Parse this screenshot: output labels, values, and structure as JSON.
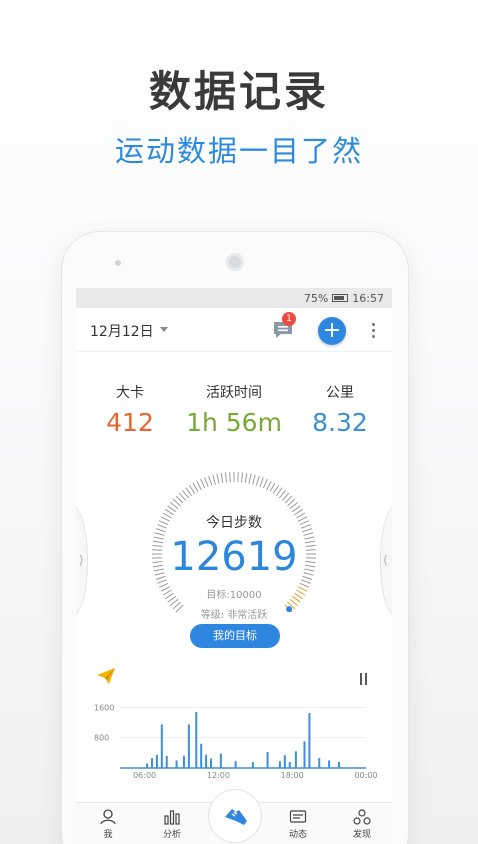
{
  "promo": {
    "title": "数据记录",
    "subtitle": "运动数据一目了然"
  },
  "status_bar": {
    "battery": "75%",
    "time": "16:57"
  },
  "app_bar": {
    "date": "12月12日",
    "message_badge": "1",
    "add_label": "+"
  },
  "stats": [
    {
      "label": "大卡",
      "value": "412",
      "color": "#e8662b"
    },
    {
      "label": "活跃时间",
      "value": "1h 56m",
      "color": "#77aa33"
    },
    {
      "label": "公里",
      "value": "8.32",
      "color": "#3d8fd8"
    }
  ],
  "gauge": {
    "label": "今日步数",
    "steps": "12619",
    "goal_text": "目标:10000",
    "level_text": "等级: 非常活跃",
    "button_label": "我的目标",
    "progress": 1.0
  },
  "chart_data": {
    "type": "bar",
    "y_ticks": [
      "1600",
      "800"
    ],
    "x_ticks": [
      "06:00",
      "12:00",
      "18:00",
      "00:00"
    ],
    "ylim": [
      0,
      1900
    ],
    "bar_hours": [
      6.2,
      6.6,
      7.0,
      7.4,
      7.8,
      8.6,
      9.2,
      9.6,
      10.2,
      10.6,
      11.0,
      11.4,
      12.2,
      13.4,
      14.8,
      16.0,
      17.0,
      17.4,
      17.8,
      18.3,
      19.0,
      19.4,
      20.2,
      21.0,
      21.8
    ],
    "values": [
      120,
      260,
      350,
      1150,
      320,
      200,
      320,
      1150,
      1480,
      640,
      350,
      250,
      380,
      180,
      160,
      420,
      180,
      340,
      160,
      440,
      700,
      1450,
      260,
      200,
      160
    ],
    "bar_color": "#3d8fd8",
    "grid": false
  },
  "tabs": [
    {
      "key": "me",
      "label": "我"
    },
    {
      "key": "analysis",
      "label": "分析"
    },
    {
      "key": "feed",
      "label": "动态"
    },
    {
      "key": "discover",
      "label": "发现"
    }
  ],
  "icons": {
    "message": "message-icon",
    "add": "plus-icon",
    "more": "more-vertical-icon",
    "plane": "paper-plane-icon",
    "pause": "pause-icon",
    "shoe": "running-shoe-icon"
  },
  "colors": {
    "accent": "#2f86e0",
    "badge": "#f04a3c"
  }
}
